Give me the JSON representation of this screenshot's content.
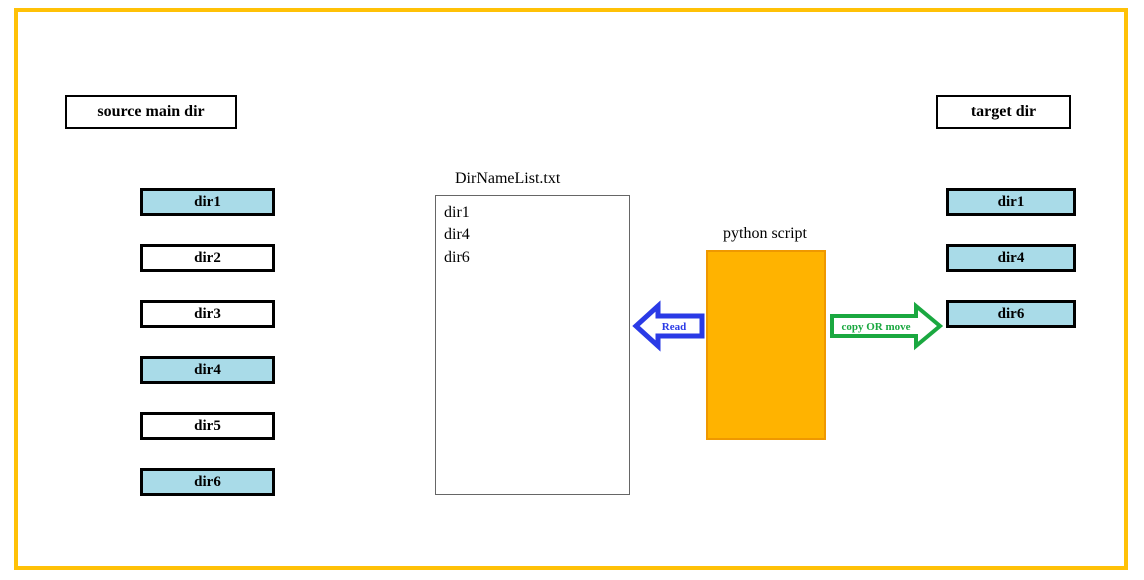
{
  "labels": {
    "source": "source main dir",
    "target": "target dir",
    "file_name": "DirNameList.txt",
    "script": "python script",
    "read_arrow": "Read",
    "copy_arrow": "copy OR move"
  },
  "source_dirs": [
    {
      "name": "dir1",
      "selected": true
    },
    {
      "name": "dir2",
      "selected": false
    },
    {
      "name": "dir3",
      "selected": false
    },
    {
      "name": "dir4",
      "selected": true
    },
    {
      "name": "dir5",
      "selected": false
    },
    {
      "name": "dir6",
      "selected": true
    }
  ],
  "file_contents": [
    "dir1",
    "dir4",
    "dir6"
  ],
  "target_dirs": [
    "dir1",
    "dir4",
    "dir6"
  ],
  "colors": {
    "frame": "#ffc107",
    "selected_fill": "#a9dbe8",
    "script_fill": "#ffb300",
    "read_arrow": "#2a3ae6",
    "copy_arrow": "#1aa840"
  }
}
